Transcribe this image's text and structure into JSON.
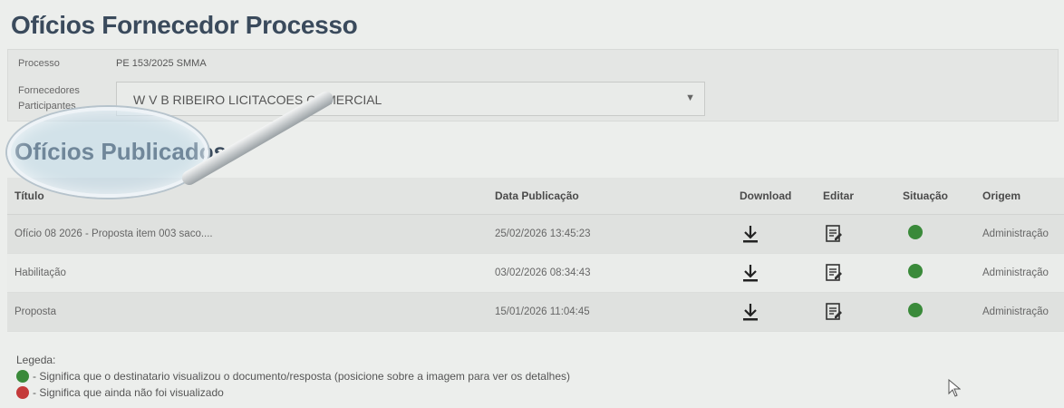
{
  "page_title": "Ofícios Fornecedor Processo",
  "form": {
    "processo_label": "Processo",
    "processo_value": "PE 153/2025 SMMA",
    "fornecedores_label": "Fornecedores Participantes",
    "fornecedor_selected": "W V B RIBEIRO LICITACOES COMERCIAL"
  },
  "section_title": "Ofícios Publicados",
  "table": {
    "headers": {
      "titulo": "Título",
      "data": "Data Publicação",
      "download": "Download",
      "editar": "Editar",
      "situacao": "Situação",
      "origem": "Origem"
    },
    "rows": [
      {
        "titulo": "Ofício 08 2026 - Proposta item 003 saco....",
        "data": "25/02/2026 13:45:23",
        "situacao": "visualizado",
        "origem": "Administração"
      },
      {
        "titulo": "Habilitação",
        "data": "03/02/2026 08:34:43",
        "situacao": "visualizado",
        "origem": "Administração"
      },
      {
        "titulo": "Proposta",
        "data": "15/01/2026 11:04:45",
        "situacao": "visualizado",
        "origem": "Administração"
      }
    ]
  },
  "legend": {
    "title": "Legeda:",
    "green_text": "- Significa que o destinatario visualizou o documento/resposta (posicione sobre a imagem para ver os detalhes)",
    "red_text": "- Significa que ainda não foi visualizado"
  },
  "colors": {
    "status_green": "#3a8a3a",
    "status_red": "#c43a3a",
    "title_color": "#3a4a5c"
  },
  "icons": {
    "download": "download-icon",
    "edit": "edit-icon",
    "status": "status-dot-icon",
    "select": "chevron-down-icon"
  }
}
